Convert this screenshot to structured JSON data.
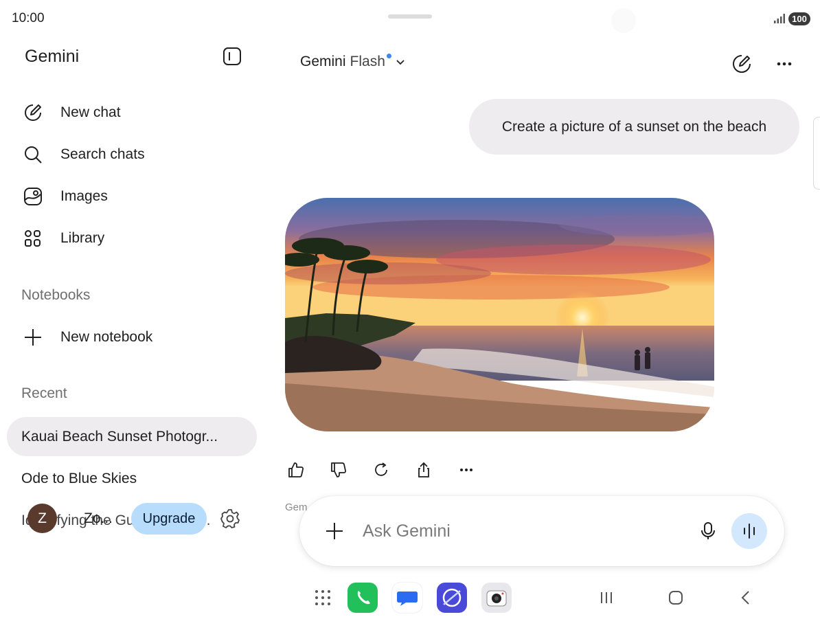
{
  "status_bar": {
    "time": "10:00",
    "battery": "100"
  },
  "sidebar": {
    "app_title": "Gemini",
    "nav": [
      {
        "label": "New chat",
        "icon": "new-chat-icon"
      },
      {
        "label": "Search chats",
        "icon": "search-icon"
      },
      {
        "label": "Images",
        "icon": "images-icon"
      },
      {
        "label": "Library",
        "icon": "library-icon"
      }
    ],
    "notebooks_label": "Notebooks",
    "new_notebook_label": "New notebook",
    "recent_label": "Recent",
    "recent": [
      "Kauai Beach Sunset Photogr...",
      "Ode to Blue Skies",
      "Identifying the Guzmania Br..."
    ],
    "account": {
      "avatar_letter": "Z",
      "name": "Zo...",
      "upgrade_label": "Upgrade"
    }
  },
  "main": {
    "model_name": "Gemini",
    "model_variant": "Flash",
    "user_prompt": "Create a picture of a sunset on the beach",
    "disclaimer_partial": "Gem",
    "input_placeholder": "Ask Gemini"
  },
  "colors": {
    "accent_dot": "#3d84f4",
    "upgrade_bg": "#b8dcfb",
    "live_btn_bg": "#d3e8fd",
    "bubble_bg": "#eeecef"
  }
}
